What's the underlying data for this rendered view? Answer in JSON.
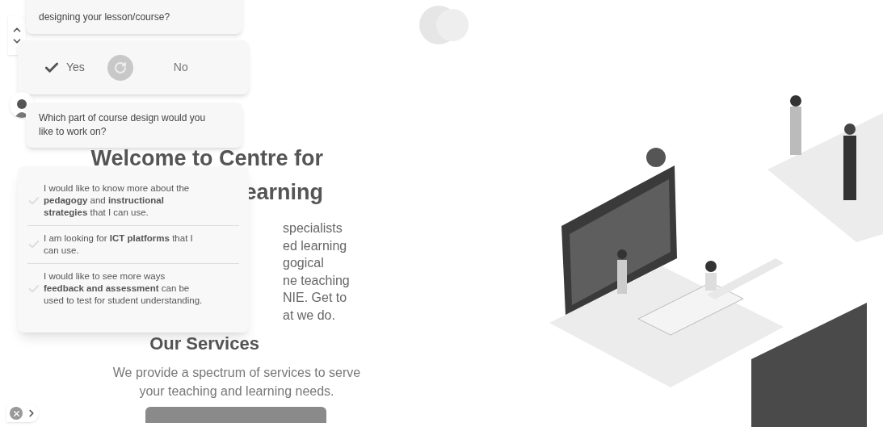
{
  "chat": {
    "messages": [
      {
        "text": "designing your lesson/course?"
      },
      {
        "text": "Which part of course design would you like to work on?"
      }
    ],
    "answers": [
      {
        "label": "Yes",
        "selected": true
      },
      {
        "label": "No",
        "selected": false
      }
    ],
    "options": [
      {
        "text": "I would like to know more about the **pedagogy** and **instructional strategies** that I can use.",
        "checked": false
      },
      {
        "text": "I am looking for **ICT platforms** that I can use.",
        "checked": false
      },
      {
        "text": "I would like to see more ways **feedback and assessment** can be used to test for student understanding.",
        "checked": false
      }
    ]
  },
  "page": {
    "heading": "Welcome to Centre for",
    "heading_fragment": "earning",
    "intro_fragments": [
      "specialists",
      "ed learning",
      "gogical",
      "ne teaching",
      "NIE. Get to",
      "at we do."
    ],
    "services_title": "Our Services",
    "services_text": "We provide a spectrum of services to serve your teaching and learning needs."
  }
}
